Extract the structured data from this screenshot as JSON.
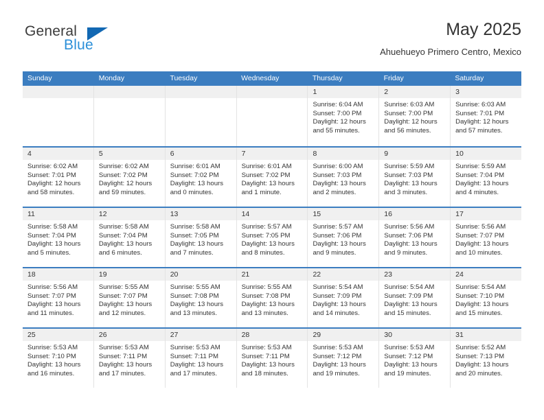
{
  "brand": {
    "name_top": "General",
    "name_bottom": "Blue"
  },
  "header": {
    "title": "May 2025",
    "subtitle": "Ahuehueyo Primero Centro, Mexico"
  },
  "calendar": {
    "weekdays": [
      "Sunday",
      "Monday",
      "Tuesday",
      "Wednesday",
      "Thursday",
      "Friday",
      "Saturday"
    ],
    "labels": {
      "sunrise": "Sunrise:",
      "sunset": "Sunset:",
      "daylight": "Daylight:"
    },
    "weeks": [
      [
        {
          "day": ""
        },
        {
          "day": ""
        },
        {
          "day": ""
        },
        {
          "day": ""
        },
        {
          "day": "1",
          "sunrise": "Sunrise: 6:04 AM",
          "sunset": "Sunset: 7:00 PM",
          "daylight1": "Daylight: 12 hours",
          "daylight2": "and 55 minutes."
        },
        {
          "day": "2",
          "sunrise": "Sunrise: 6:03 AM",
          "sunset": "Sunset: 7:00 PM",
          "daylight1": "Daylight: 12 hours",
          "daylight2": "and 56 minutes."
        },
        {
          "day": "3",
          "sunrise": "Sunrise: 6:03 AM",
          "sunset": "Sunset: 7:01 PM",
          "daylight1": "Daylight: 12 hours",
          "daylight2": "and 57 minutes."
        }
      ],
      [
        {
          "day": "4",
          "sunrise": "Sunrise: 6:02 AM",
          "sunset": "Sunset: 7:01 PM",
          "daylight1": "Daylight: 12 hours",
          "daylight2": "and 58 minutes."
        },
        {
          "day": "5",
          "sunrise": "Sunrise: 6:02 AM",
          "sunset": "Sunset: 7:02 PM",
          "daylight1": "Daylight: 12 hours",
          "daylight2": "and 59 minutes."
        },
        {
          "day": "6",
          "sunrise": "Sunrise: 6:01 AM",
          "sunset": "Sunset: 7:02 PM",
          "daylight1": "Daylight: 13 hours",
          "daylight2": "and 0 minutes."
        },
        {
          "day": "7",
          "sunrise": "Sunrise: 6:01 AM",
          "sunset": "Sunset: 7:02 PM",
          "daylight1": "Daylight: 13 hours",
          "daylight2": "and 1 minute."
        },
        {
          "day": "8",
          "sunrise": "Sunrise: 6:00 AM",
          "sunset": "Sunset: 7:03 PM",
          "daylight1": "Daylight: 13 hours",
          "daylight2": "and 2 minutes."
        },
        {
          "day": "9",
          "sunrise": "Sunrise: 5:59 AM",
          "sunset": "Sunset: 7:03 PM",
          "daylight1": "Daylight: 13 hours",
          "daylight2": "and 3 minutes."
        },
        {
          "day": "10",
          "sunrise": "Sunrise: 5:59 AM",
          "sunset": "Sunset: 7:04 PM",
          "daylight1": "Daylight: 13 hours",
          "daylight2": "and 4 minutes."
        }
      ],
      [
        {
          "day": "11",
          "sunrise": "Sunrise: 5:58 AM",
          "sunset": "Sunset: 7:04 PM",
          "daylight1": "Daylight: 13 hours",
          "daylight2": "and 5 minutes."
        },
        {
          "day": "12",
          "sunrise": "Sunrise: 5:58 AM",
          "sunset": "Sunset: 7:04 PM",
          "daylight1": "Daylight: 13 hours",
          "daylight2": "and 6 minutes."
        },
        {
          "day": "13",
          "sunrise": "Sunrise: 5:58 AM",
          "sunset": "Sunset: 7:05 PM",
          "daylight1": "Daylight: 13 hours",
          "daylight2": "and 7 minutes."
        },
        {
          "day": "14",
          "sunrise": "Sunrise: 5:57 AM",
          "sunset": "Sunset: 7:05 PM",
          "daylight1": "Daylight: 13 hours",
          "daylight2": "and 8 minutes."
        },
        {
          "day": "15",
          "sunrise": "Sunrise: 5:57 AM",
          "sunset": "Sunset: 7:06 PM",
          "daylight1": "Daylight: 13 hours",
          "daylight2": "and 9 minutes."
        },
        {
          "day": "16",
          "sunrise": "Sunrise: 5:56 AM",
          "sunset": "Sunset: 7:06 PM",
          "daylight1": "Daylight: 13 hours",
          "daylight2": "and 9 minutes."
        },
        {
          "day": "17",
          "sunrise": "Sunrise: 5:56 AM",
          "sunset": "Sunset: 7:07 PM",
          "daylight1": "Daylight: 13 hours",
          "daylight2": "and 10 minutes."
        }
      ],
      [
        {
          "day": "18",
          "sunrise": "Sunrise: 5:56 AM",
          "sunset": "Sunset: 7:07 PM",
          "daylight1": "Daylight: 13 hours",
          "daylight2": "and 11 minutes."
        },
        {
          "day": "19",
          "sunrise": "Sunrise: 5:55 AM",
          "sunset": "Sunset: 7:07 PM",
          "daylight1": "Daylight: 13 hours",
          "daylight2": "and 12 minutes."
        },
        {
          "day": "20",
          "sunrise": "Sunrise: 5:55 AM",
          "sunset": "Sunset: 7:08 PM",
          "daylight1": "Daylight: 13 hours",
          "daylight2": "and 13 minutes."
        },
        {
          "day": "21",
          "sunrise": "Sunrise: 5:55 AM",
          "sunset": "Sunset: 7:08 PM",
          "daylight1": "Daylight: 13 hours",
          "daylight2": "and 13 minutes."
        },
        {
          "day": "22",
          "sunrise": "Sunrise: 5:54 AM",
          "sunset": "Sunset: 7:09 PM",
          "daylight1": "Daylight: 13 hours",
          "daylight2": "and 14 minutes."
        },
        {
          "day": "23",
          "sunrise": "Sunrise: 5:54 AM",
          "sunset": "Sunset: 7:09 PM",
          "daylight1": "Daylight: 13 hours",
          "daylight2": "and 15 minutes."
        },
        {
          "day": "24",
          "sunrise": "Sunrise: 5:54 AM",
          "sunset": "Sunset: 7:10 PM",
          "daylight1": "Daylight: 13 hours",
          "daylight2": "and 15 minutes."
        }
      ],
      [
        {
          "day": "25",
          "sunrise": "Sunrise: 5:53 AM",
          "sunset": "Sunset: 7:10 PM",
          "daylight1": "Daylight: 13 hours",
          "daylight2": "and 16 minutes."
        },
        {
          "day": "26",
          "sunrise": "Sunrise: 5:53 AM",
          "sunset": "Sunset: 7:11 PM",
          "daylight1": "Daylight: 13 hours",
          "daylight2": "and 17 minutes."
        },
        {
          "day": "27",
          "sunrise": "Sunrise: 5:53 AM",
          "sunset": "Sunset: 7:11 PM",
          "daylight1": "Daylight: 13 hours",
          "daylight2": "and 17 minutes."
        },
        {
          "day": "28",
          "sunrise": "Sunrise: 5:53 AM",
          "sunset": "Sunset: 7:11 PM",
          "daylight1": "Daylight: 13 hours",
          "daylight2": "and 18 minutes."
        },
        {
          "day": "29",
          "sunrise": "Sunrise: 5:53 AM",
          "sunset": "Sunset: 7:12 PM",
          "daylight1": "Daylight: 13 hours",
          "daylight2": "and 19 minutes."
        },
        {
          "day": "30",
          "sunrise": "Sunrise: 5:53 AM",
          "sunset": "Sunset: 7:12 PM",
          "daylight1": "Daylight: 13 hours",
          "daylight2": "and 19 minutes."
        },
        {
          "day": "31",
          "sunrise": "Sunrise: 5:52 AM",
          "sunset": "Sunset: 7:13 PM",
          "daylight1": "Daylight: 13 hours",
          "daylight2": "and 20 minutes."
        }
      ]
    ]
  },
  "colors": {
    "header_blue": "#3b7dc0",
    "logo_blue": "#2b8fd8",
    "logo_triangle": "#1268b3",
    "cell_date_bg": "#f0f0f0"
  }
}
